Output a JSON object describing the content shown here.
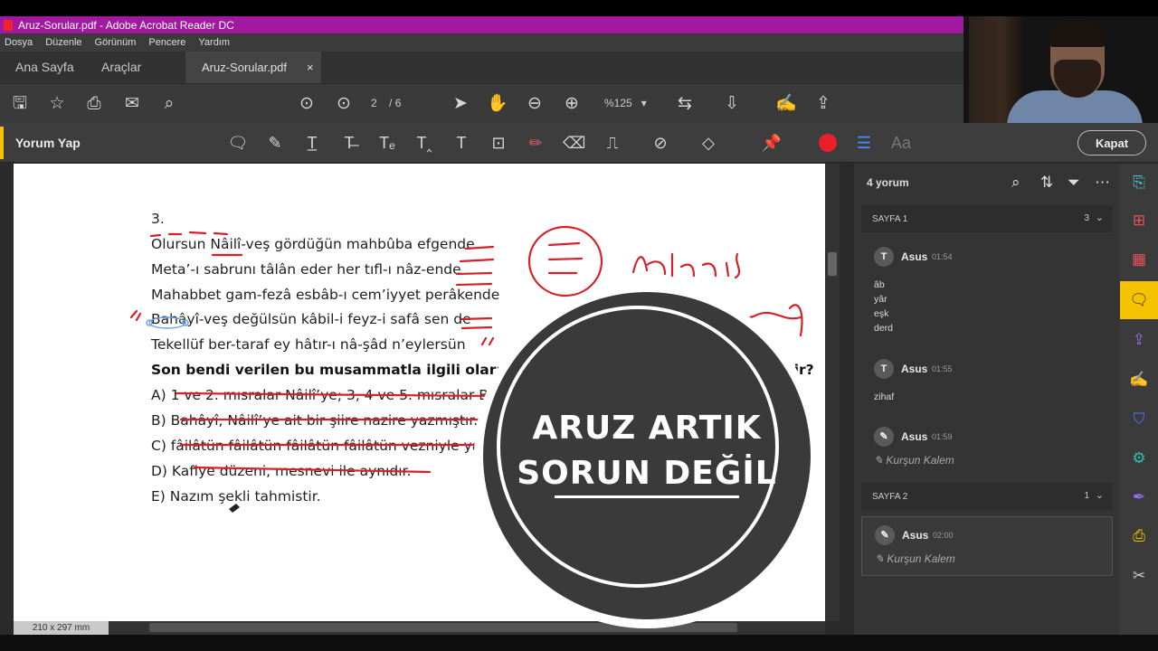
{
  "window": {
    "title": "Aruz-Sorular.pdf - Adobe Acrobat Reader DC"
  },
  "menu": [
    "Dosya",
    "Düzenle",
    "Görünüm",
    "Pencere",
    "Yardım"
  ],
  "tabs": {
    "home": "Ana Sayfa",
    "tools": "Araçlar",
    "document": "Aruz-Sorular.pdf",
    "close_glyph": "×"
  },
  "toolbar": {
    "page_current": "2",
    "page_total": "/ 6",
    "zoom": "%125"
  },
  "comment_bar": {
    "label": "Yorum Yap",
    "close_button": "Kapat",
    "font_glyph": "Aa"
  },
  "document": {
    "number": "3.",
    "lines": [
      "Olursun Nâilî-veş gördüğün mahbûba efgende",
      "Meta’-ı sabrunı tâlân eder her tıfl-ı nâz-ende",
      "Mahabbet gam-fezâ esbâb-ı cem’iyyet perâkende",
      "Bahâyî-veş değülsün kâbil-i feyz-i safâ sen de",
      "Tekellüf ber-taraf ey hâtır-ı nâ-şâd n’eylersün"
    ],
    "question": "Son bendi verilen bu musammatla ilgili olarak aşağıdakilerden hangisi söylenebilir?",
    "options": [
      "A) 1 ve 2. mısralar Nâilî’ye; 3, 4 ve 5. mısralar Bahâyî’ye aittir.",
      "B) Bahâyî, Nâilî’ye ait bir şiire nazire yazmıştır.",
      "C) fâilâtün fâilâtün fâilâtün fâilâtün vezniyle yazılmıştır.",
      "D) Kafiye düzeni, mesnevi ile aynıdır.",
      "E) Nazım şekli tahmistir."
    ],
    "page_size": "210 x 297 mm",
    "handwriting": {
      "word1": "tahmis",
      "word2": "muhammes"
    }
  },
  "panel": {
    "count": "4 yorum",
    "sections": [
      {
        "label": "SAYFA 1",
        "count": "3"
      },
      {
        "label": "SAYFA 2",
        "count": "1"
      }
    ],
    "comments": [
      {
        "avatar": "T",
        "author": "Asus",
        "time": "01:54",
        "body": "âb\nyâr\neşk\nderd"
      },
      {
        "avatar": "T",
        "author": "Asus",
        "time": "01:55",
        "body": "zihaf"
      },
      {
        "avatar": "✎",
        "author": "Asus",
        "time": "01:59",
        "body": "Kurşun Kalem"
      },
      {
        "avatar": "✎",
        "author": "Asus",
        "time": "02:00",
        "body": "Kurşun Kalem"
      }
    ]
  },
  "overlay": {
    "line1": "ARUZ ARTIK",
    "line2": "SORUN DEĞİL"
  },
  "colors": {
    "title_bar": "#a0199e",
    "accent_yellow": "#f5c200",
    "ink_red": "#d8202a",
    "record_red": "#e8202a"
  }
}
